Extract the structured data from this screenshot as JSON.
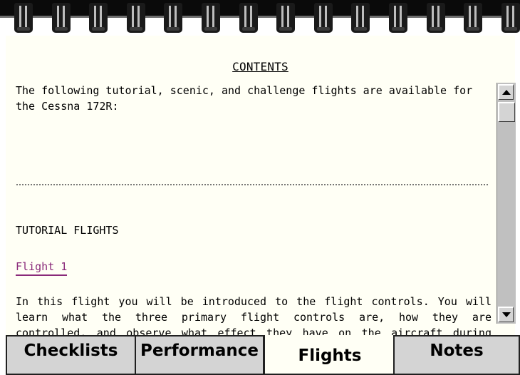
{
  "page": {
    "title": "CONTENTS",
    "intro": "The following tutorial, scenic, and challenge flights are available for the Cessna 172R:",
    "section_heading": "TUTORIAL FLIGHTS",
    "flight_link": "Flight 1",
    "flight_description": "In this flight you will be introduced to the flight controls. You will learn what the three primary flight controls are, how they are controlled, and observe what effect they have on the aircraft during flight. You will also learn the proper use of trimming and the effects of making power changes."
  },
  "tabs": [
    {
      "label": "Checklists",
      "active": false
    },
    {
      "label": "Performance",
      "active": false
    },
    {
      "label": "Flights",
      "active": true
    },
    {
      "label": "Notes",
      "active": false
    }
  ],
  "scrollbar": {
    "up_icon": "arrow-up-icon",
    "down_icon": "arrow-down-icon"
  },
  "colors": {
    "page_background": "#fffff5",
    "link": "#8a2a7a",
    "tab_inactive": "#d4d4d4",
    "binding": "#0a0a0a"
  }
}
